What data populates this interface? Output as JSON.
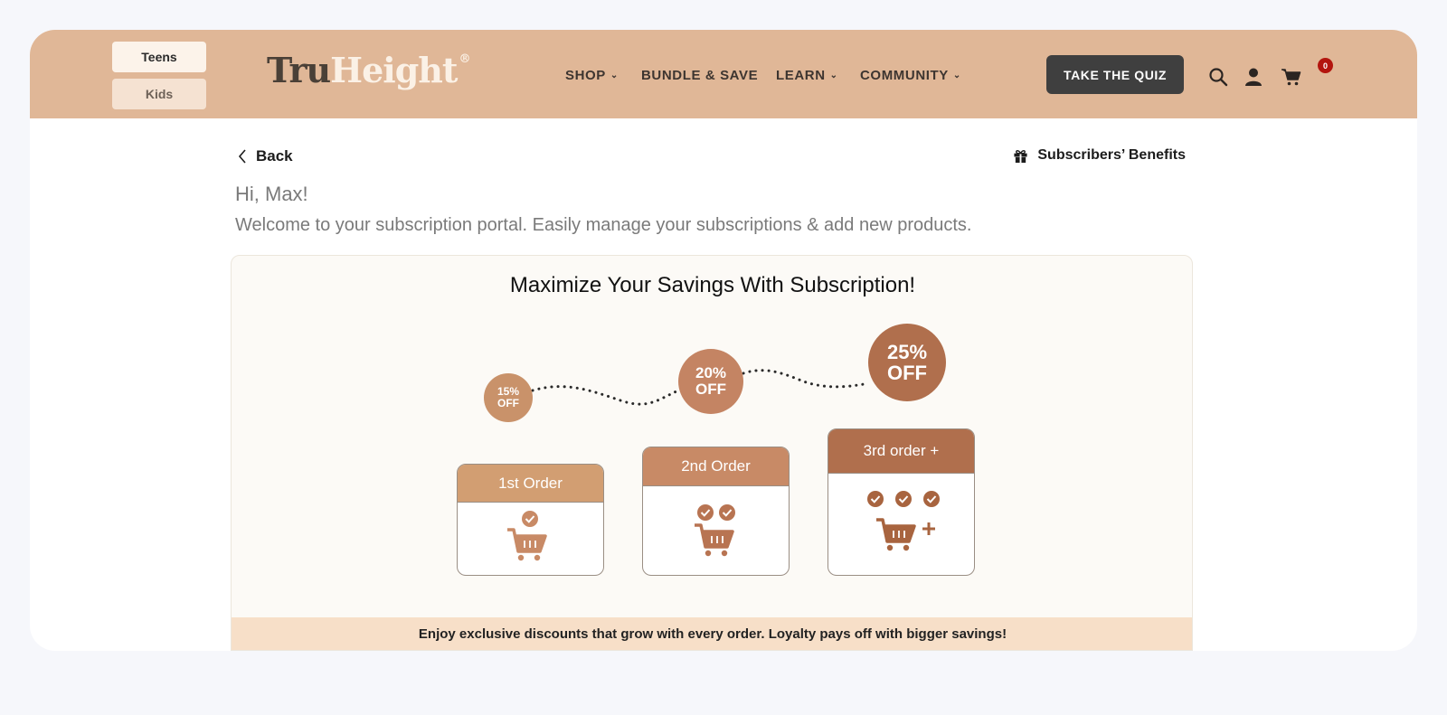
{
  "audience": {
    "teens": "Teens",
    "kids": "Kids"
  },
  "logo": {
    "part1": "Tru",
    "part2": "Height",
    "reg": "®"
  },
  "nav": {
    "shop": "SHOP",
    "bundle": "BUNDLE & SAVE",
    "learn": "LEARN",
    "community": "COMMUNITY"
  },
  "cta": {
    "quiz": "TAKE THE QUIZ"
  },
  "header_icons": [
    "search-icon",
    "account-icon",
    "cart-icon"
  ],
  "cart": {
    "count": "0"
  },
  "page": {
    "back": "Back",
    "benefits": "Subscribers’ Benefits",
    "greeting": "Hi, Max!",
    "welcome": "Welcome to your subscription portal. Easily manage your subscriptions & add new products."
  },
  "savings": {
    "title": "Maximize Your Savings With Subscription!",
    "tiers": [
      {
        "discount_pct": "15%",
        "discount_off": "OFF",
        "order": "1st Order",
        "checks": 1
      },
      {
        "discount_pct": "20%",
        "discount_off": "OFF",
        "order": "2nd Order",
        "checks": 2
      },
      {
        "discount_pct": "25%",
        "discount_off": "OFF",
        "order": "3rd order +",
        "checks": 3
      }
    ],
    "footer": "Enjoy exclusive discounts that grow with every order. Loyalty pays off with bigger savings!"
  },
  "colors": {
    "header": "#e0b797",
    "quiz_button": "#3f3f3f",
    "tier1": "#d29e72",
    "tier2": "#c88a66",
    "tier3": "#b06f4d",
    "footer": "#f7dfc8",
    "badge": "#b3150e"
  }
}
